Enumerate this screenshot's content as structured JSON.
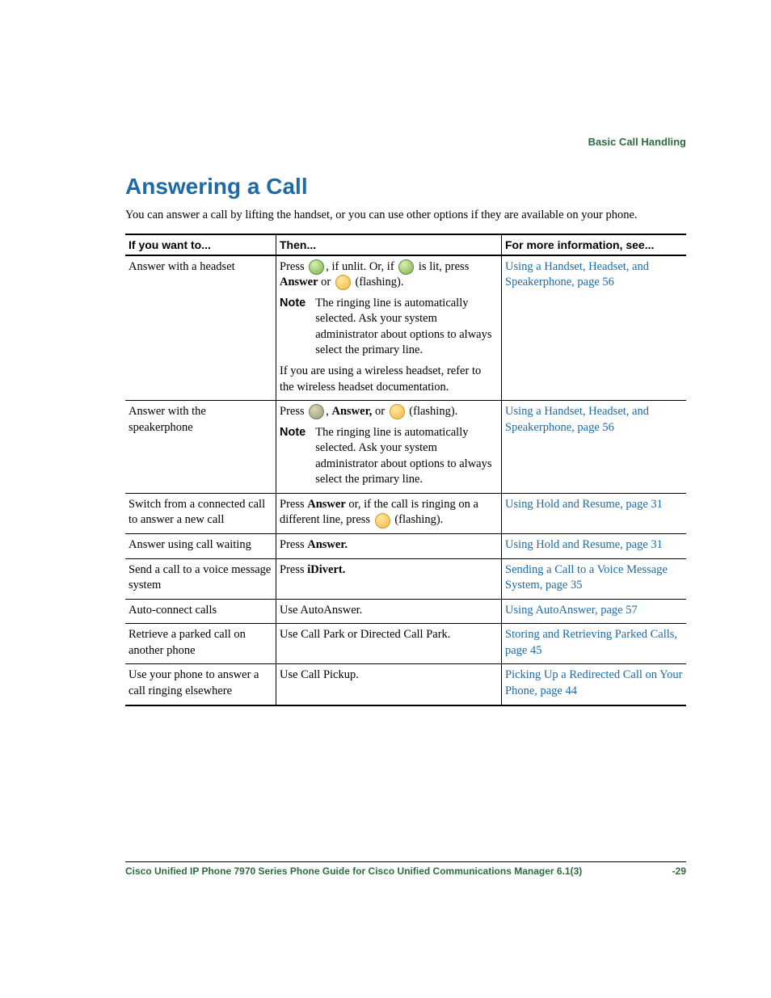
{
  "running_header": "Basic Call Handling",
  "title": "Answering a Call",
  "intro": "You can answer a call by lifting the handset, or you can use other options if they are available on your phone.",
  "headers": {
    "col1": "If you want to...",
    "col2": "Then...",
    "col3": "For more information, see..."
  },
  "note_label": "Note",
  "rows": {
    "r1": {
      "want": "Answer with a headset",
      "then_press": "Press ",
      "then_unlit": ", if unlit. Or, if ",
      "then_islit": " is lit, press ",
      "answer_word": "Answer",
      "or_word": " or ",
      "flashing": " (flashing).",
      "note_body": "The ringing line is automatically selected. Ask your system administrator about options to always select the primary line.",
      "wireless": "If you are using a wireless headset, refer to the wireless headset documentation.",
      "link": "Using a Handset, Headset, and Speakerphone, page 56"
    },
    "r2": {
      "want": "Answer with the speakerphone",
      "then_press": "Press ",
      "comma": ", ",
      "answer_word": "Answer,",
      "or_word": " or ",
      "flashing": " (flashing).",
      "note_body": "The ringing line is automatically selected. Ask your system administrator about options to always select the primary line.",
      "link": "Using a Handset, Headset, and Speakerphone, page 56"
    },
    "r3": {
      "want": "Switch from a connected call to answer a new call",
      "then_a": "Press ",
      "then_b": "Answer",
      "then_c": " or, if the call is ringing on a different line, press ",
      "flashing": " (flashing).",
      "link": "Using Hold and Resume, page 31"
    },
    "r4": {
      "want": "Answer using call waiting",
      "then_a": "Press ",
      "then_b": "Answer.",
      "link": "Using Hold and Resume, page 31"
    },
    "r5": {
      "want": "Send a call to a voice message system",
      "then_a": "Press ",
      "then_b": "iDivert.",
      "link": "Sending a Call to a Voice Message System, page 35"
    },
    "r6": {
      "want": "Auto-connect calls",
      "then": "Use AutoAnswer.",
      "link": "Using AutoAnswer, page 57"
    },
    "r7": {
      "want": "Retrieve a parked call on another phone",
      "then": "Use Call Park or Directed Call Park.",
      "link": "Storing and Retrieving Parked Calls, page 45"
    },
    "r8": {
      "want": "Use your phone to answer a call ringing elsewhere",
      "then": "Use Call Pickup.",
      "link": "Picking Up a Redirected Call on Your Phone, page 44"
    }
  },
  "footer": {
    "title": "Cisco Unified IP Phone 7970 Series Phone Guide for Cisco Unified Communications Manager 6.1(3)",
    "page": "-29"
  }
}
